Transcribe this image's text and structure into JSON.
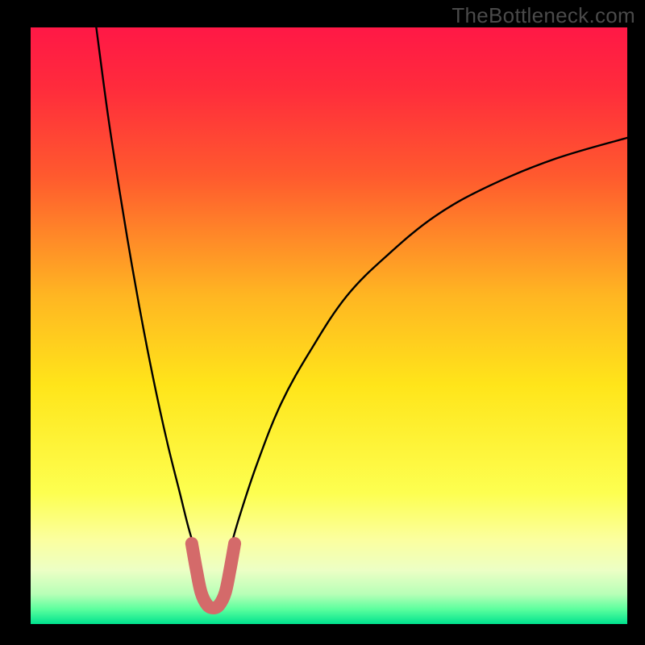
{
  "watermark": "TheBottleneck.com",
  "chart_data": {
    "type": "line",
    "title": "",
    "xlabel": "",
    "ylabel": "",
    "xlim": [
      0,
      100
    ],
    "ylim": [
      0,
      100
    ],
    "grid": false,
    "legend": false,
    "gradient_stops": [
      {
        "offset": 0.0,
        "color": "#ff1846"
      },
      {
        "offset": 0.1,
        "color": "#ff2b3c"
      },
      {
        "offset": 0.25,
        "color": "#ff5a2e"
      },
      {
        "offset": 0.45,
        "color": "#ffb622"
      },
      {
        "offset": 0.6,
        "color": "#ffe51a"
      },
      {
        "offset": 0.78,
        "color": "#fdff50"
      },
      {
        "offset": 0.86,
        "color": "#fbffa0"
      },
      {
        "offset": 0.91,
        "color": "#ecffc5"
      },
      {
        "offset": 0.95,
        "color": "#b7ffb7"
      },
      {
        "offset": 0.975,
        "color": "#5cff9e"
      },
      {
        "offset": 1.0,
        "color": "#00e28e"
      }
    ],
    "series": [
      {
        "name": "left-branch",
        "stroke": "#000000",
        "points": [
          {
            "x": 11.0,
            "y": 100.0
          },
          {
            "x": 13.0,
            "y": 85.0
          },
          {
            "x": 15.0,
            "y": 72.0
          },
          {
            "x": 17.0,
            "y": 60.0
          },
          {
            "x": 19.0,
            "y": 49.0
          },
          {
            "x": 21.0,
            "y": 39.0
          },
          {
            "x": 23.0,
            "y": 30.0
          },
          {
            "x": 25.0,
            "y": 22.0
          },
          {
            "x": 26.5,
            "y": 16.0
          },
          {
            "x": 28.0,
            "y": 11.0
          }
        ]
      },
      {
        "name": "right-branch",
        "stroke": "#000000",
        "points": [
          {
            "x": 33.0,
            "y": 11.0
          },
          {
            "x": 35.0,
            "y": 18.0
          },
          {
            "x": 38.0,
            "y": 27.0
          },
          {
            "x": 42.0,
            "y": 37.0
          },
          {
            "x": 47.0,
            "y": 46.0
          },
          {
            "x": 53.0,
            "y": 55.0
          },
          {
            "x": 60.0,
            "y": 62.0
          },
          {
            "x": 68.0,
            "y": 68.5
          },
          {
            "x": 77.0,
            "y": 73.5
          },
          {
            "x": 88.0,
            "y": 78.0
          },
          {
            "x": 100.0,
            "y": 81.5
          }
        ]
      },
      {
        "name": "notch-marker",
        "stroke": "#d46a6a",
        "thick": true,
        "points": [
          {
            "x": 27.0,
            "y": 13.5
          },
          {
            "x": 27.8,
            "y": 9.0
          },
          {
            "x": 28.6,
            "y": 5.2
          },
          {
            "x": 29.6,
            "y": 3.2
          },
          {
            "x": 30.6,
            "y": 2.7
          },
          {
            "x": 31.6,
            "y": 3.2
          },
          {
            "x": 32.6,
            "y": 5.2
          },
          {
            "x": 33.4,
            "y": 9.0
          },
          {
            "x": 34.2,
            "y": 13.5
          }
        ]
      }
    ]
  }
}
